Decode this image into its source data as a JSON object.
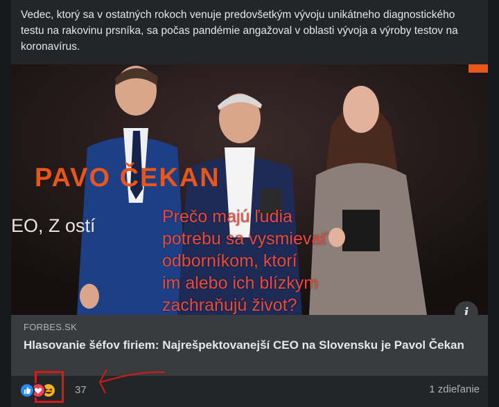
{
  "post": {
    "text": "Vedec, ktorý sa v ostatných rokoch venuje predovšetkým vývoju unikátneho diagnostického testu na rakovinu prsníka, sa počas pandémie angažoval v oblasti vývoja a výroby testov na koronavírus."
  },
  "image": {
    "banner_name": "PAVO  ČEKAN",
    "banner_subtitle": "EO, Z              ostí",
    "overlay_text": "Prečo majú ľudia\npotrebu sa vysmievať\nodborníkom, ktorí\nim alebo ich blízkym\nzachraňujú život?",
    "info_icon": "info-icon"
  },
  "link_preview": {
    "domain": "FORBES.SK",
    "title": "Hlasovanie šéfov firiem: Najrešpektovanejší CEO na Slovensku je Pavol Čekan"
  },
  "engagement": {
    "reaction_icons": [
      "like-icon",
      "love-icon",
      "haha-icon"
    ],
    "reaction_count": "37",
    "shares": "1 zdieľanie"
  },
  "colors": {
    "background": "#18191a",
    "card": "#242526",
    "link_card": "#3a3b3c",
    "annotation_red": "#d41c1c",
    "overlay_text": "#e84c3d"
  }
}
